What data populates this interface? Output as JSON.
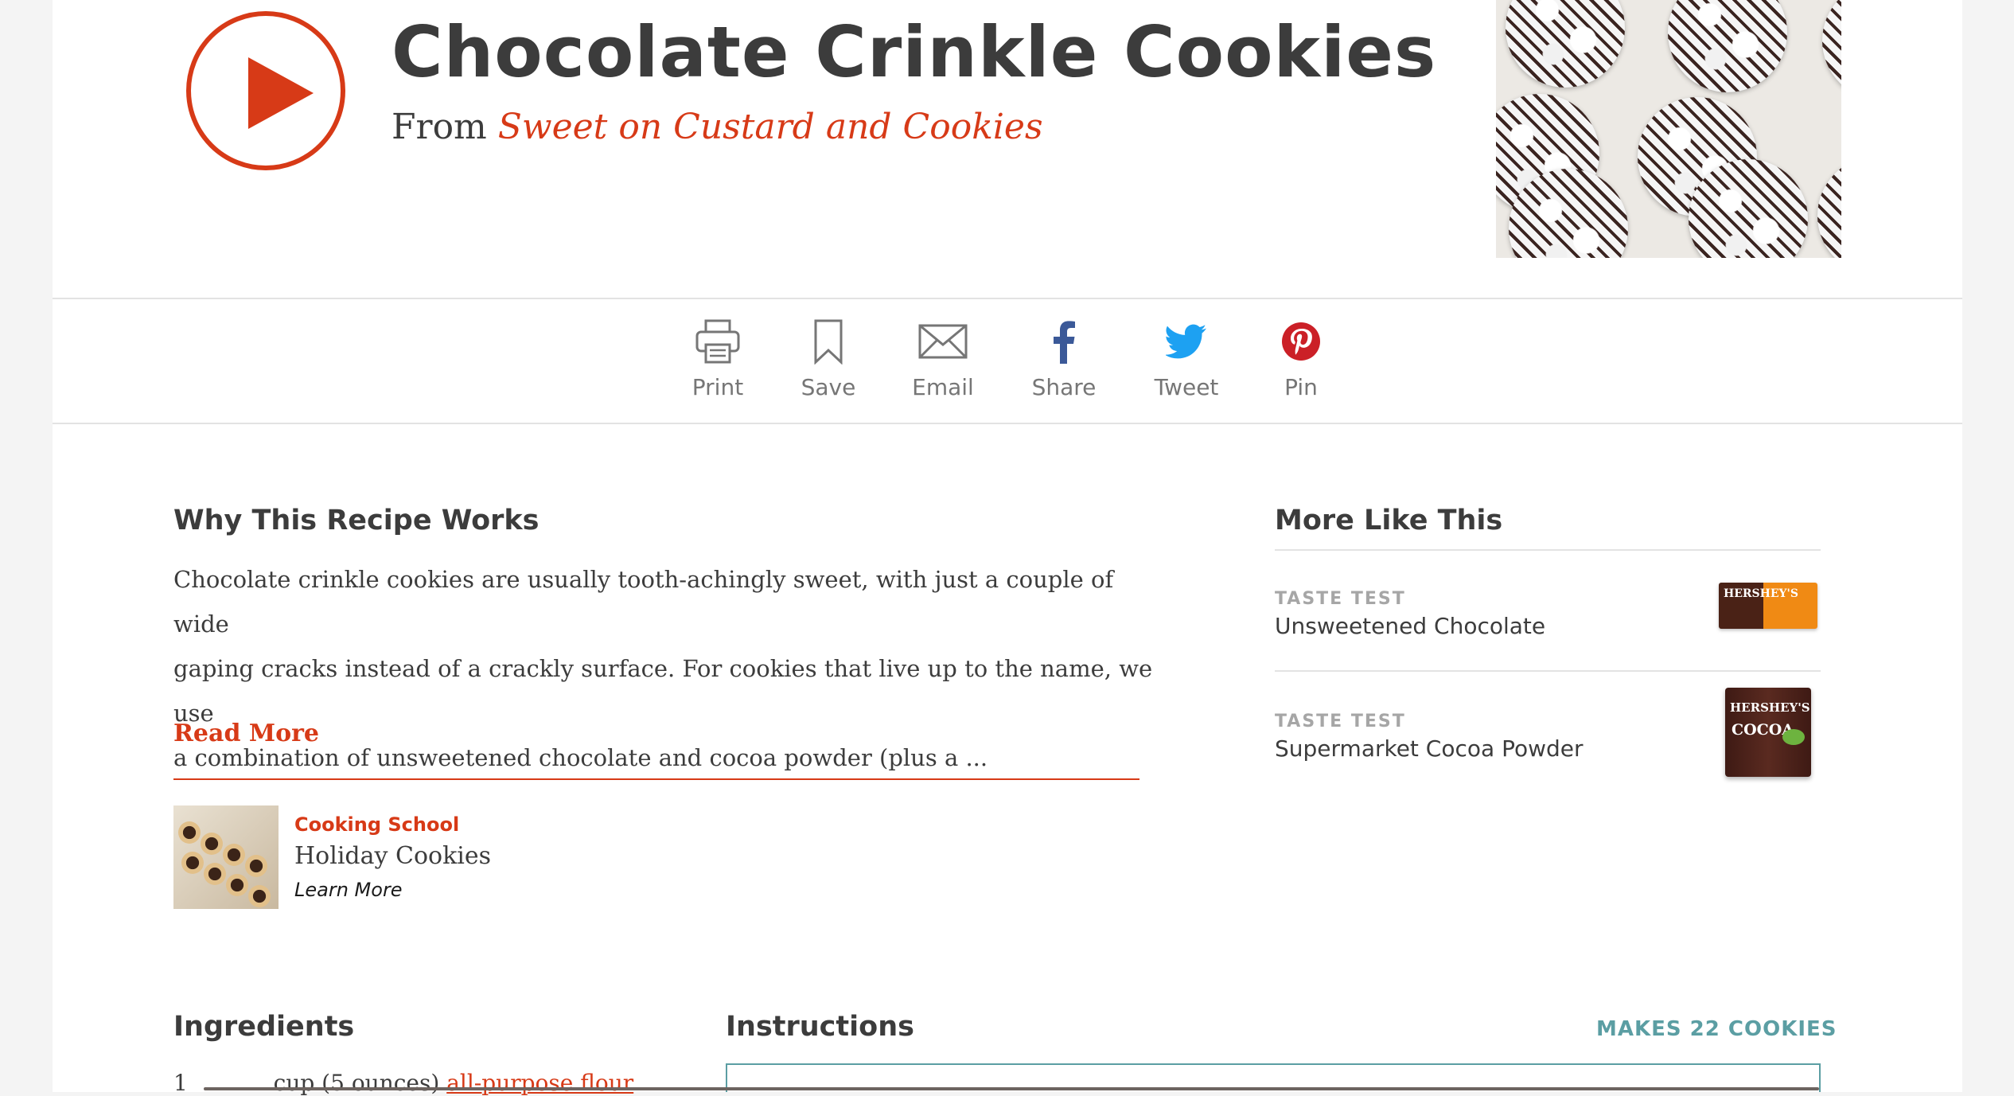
{
  "recipe": {
    "title": "Chocolate Crinkle Cookies",
    "from_label": "From",
    "source": "Sweet on Custard and Cookies"
  },
  "icons": {
    "play": "play-icon",
    "print": "printer-icon",
    "save": "bookmark-icon",
    "email": "envelope-icon",
    "share": "facebook-icon",
    "tweet": "twitter-icon",
    "pin": "pinterest-icon"
  },
  "share_bar": {
    "print": "Print",
    "save": "Save",
    "email": "Email",
    "share": "Share",
    "tweet": "Tweet",
    "pin": "Pin"
  },
  "why": {
    "heading": "Why This Recipe Works",
    "lines": [
      "Chocolate crinkle cookies are usually tooth-achingly sweet, with just a couple of wide",
      "gaping cracks instead of a crackly surface. For cookies that live up to the name, we use",
      "a combination of unsweetened chocolate and cocoa powder (plus a ..."
    ],
    "read_more": "Read More"
  },
  "cooking_school": {
    "kicker": "Cooking School",
    "title": "Holiday Cookies",
    "link": "Learn More"
  },
  "more_like_this": {
    "heading": "More Like This",
    "items": [
      {
        "kicker": "TASTE TEST",
        "title": "Unsweetened Chocolate",
        "brand": "HERSHEY'S"
      },
      {
        "kicker": "TASTE TEST",
        "title": "Supermarket Cocoa Powder",
        "brand": "HERSHEY'S",
        "sub": "COCOA"
      }
    ]
  },
  "ingredients": {
    "heading": "Ingredients",
    "first_row": {
      "qty": "1",
      "text": "cup (5 ounces)",
      "link": "all-purpose flour"
    }
  },
  "instructions": {
    "heading": "Instructions",
    "yield": "MAKES 22 COOKIES"
  },
  "colors": {
    "accent": "#d73a17",
    "teal": "#5b9ea3",
    "text": "#3c3c3c",
    "facebook": "#3b5998",
    "twitter": "#1da1f2",
    "pinterest": "#cb2027"
  }
}
